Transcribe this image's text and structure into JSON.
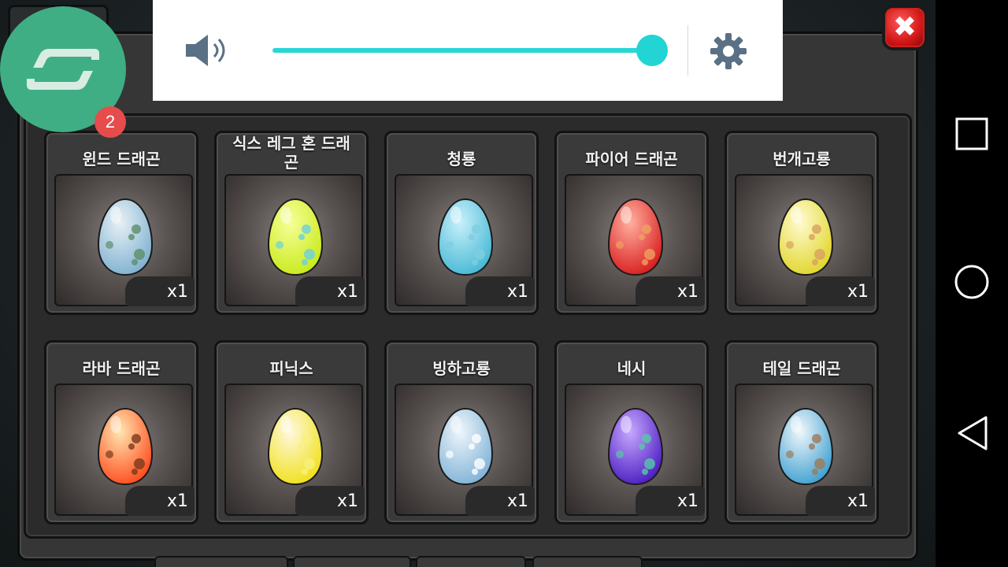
{
  "volume": {
    "level": 1.0
  },
  "overlay": {
    "badge_count": "2"
  },
  "close_label": "✖",
  "eggs": [
    {
      "name": "윈드 드래곤",
      "qty": "x1",
      "colors": [
        "#e8f1f5",
        "#7eb0d0"
      ],
      "spots": "#5c8d6a"
    },
    {
      "name": "식스 레그 혼 드래곤",
      "qty": "x1",
      "colors": [
        "#f7ff9a",
        "#c8ea1a"
      ],
      "spots": "#6bd0e0"
    },
    {
      "name": "청룡",
      "qty": "x1",
      "colors": [
        "#c8f0fb",
        "#45b8d4"
      ],
      "spots": "#7fcde0"
    },
    {
      "name": "파이어 드래곤",
      "qty": "x1",
      "colors": [
        "#ffb0a0",
        "#d81c1c"
      ],
      "spots": "#f0a060"
    },
    {
      "name": "번개고룡",
      "qty": "x1",
      "colors": [
        "#fffbd0",
        "#e0d52a"
      ],
      "spots": "#d8a060"
    },
    {
      "name": "라바 드래곤",
      "qty": "x1",
      "colors": [
        "#ffe6b0",
        "#ff4a1c"
      ],
      "spots": "#7a3a1a"
    },
    {
      "name": "피닉스",
      "qty": "x1",
      "colors": [
        "#fff8e0",
        "#f0e018"
      ],
      "spots": "#f8f080"
    },
    {
      "name": "빙하고룡",
      "qty": "x1",
      "colors": [
        "#eef6fb",
        "#7fb2d6"
      ],
      "spots": "#ffffff"
    },
    {
      "name": "네시",
      "qty": "x1",
      "colors": [
        "#c7a8ff",
        "#4a1cc0"
      ],
      "spots": "#56c8a8"
    },
    {
      "name": "테일 드래곤",
      "qty": "x1",
      "colors": [
        "#f0f7fb",
        "#3e9fd0"
      ],
      "spots": "#9a7a5a"
    }
  ]
}
